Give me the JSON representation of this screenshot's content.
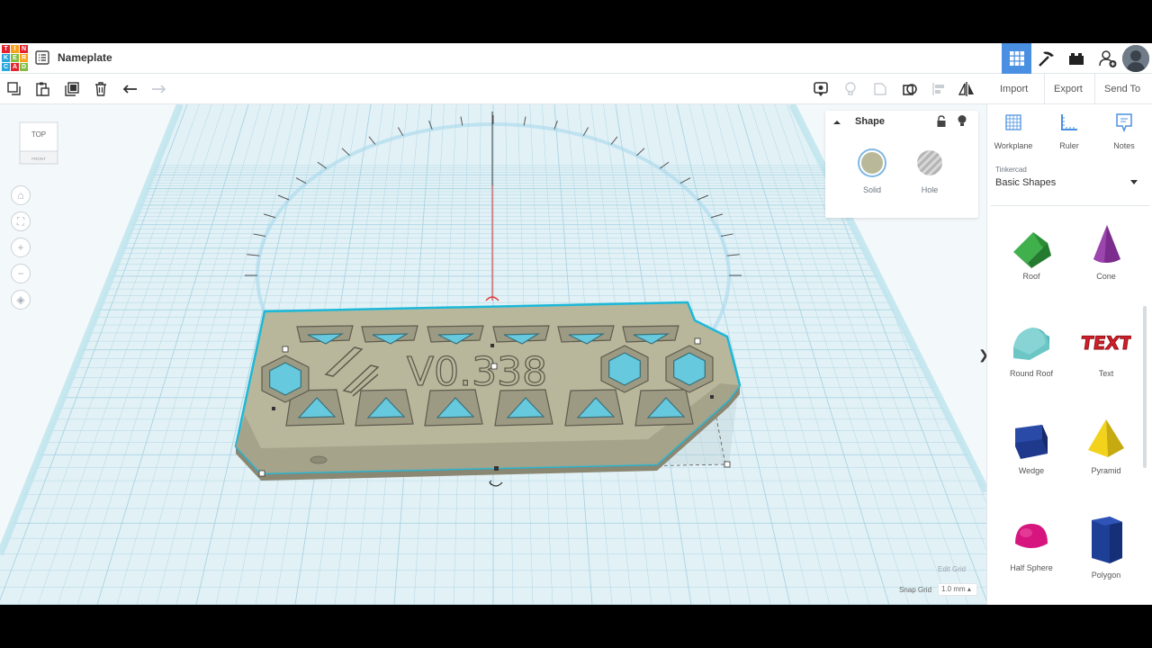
{
  "header": {
    "logo_letters": [
      "T",
      "I",
      "N",
      "K",
      "E",
      "R",
      "C",
      "A",
      "D"
    ],
    "logo_colors": [
      "#e2232f",
      "#f8a21b",
      "#e2232f",
      "#26a7df",
      "#83bc41",
      "#f8a21b",
      "#26a7df",
      "#e2232f",
      "#83bc41"
    ],
    "doc_title": "Nameplate"
  },
  "toolbar": {
    "import_label": "Import",
    "export_label": "Export",
    "sendto_label": "Send To"
  },
  "viewcube": {
    "top_label": "TOP",
    "front_label": "FRONT"
  },
  "model": {
    "text": "V0.338"
  },
  "inspector": {
    "title": "Shape",
    "solid_label": "Solid",
    "hole_label": "Hole",
    "solid_color": "#b9b99a"
  },
  "grid": {
    "edit_grid_label": "Edit Grid",
    "snap_label": "Snap Grid",
    "snap_value": "1.0 mm ▴"
  },
  "panel": {
    "tools": {
      "workplane": "Workplane",
      "ruler": "Ruler",
      "notes": "Notes"
    },
    "library_source": "Tinkercad",
    "library_name": "Basic Shapes",
    "shapes": [
      {
        "name": "Roof",
        "color": "#3fb04b"
      },
      {
        "name": "Cone",
        "color": "#7b2c8c"
      },
      {
        "name": "Round Roof",
        "color": "#6cc6c6"
      },
      {
        "name": "Text",
        "color": "#d31f2a"
      },
      {
        "name": "Wedge",
        "color": "#1f3a8c"
      },
      {
        "name": "Pyramid",
        "color": "#f2d21b"
      },
      {
        "name": "Half Sphere",
        "color": "#d6157f"
      },
      {
        "name": "Polygon",
        "color": "#1e3f96"
      }
    ]
  },
  "colors": {
    "accent": "#4a90e2",
    "grid": "#cfe6ee",
    "selection": "#1cb8d8"
  }
}
